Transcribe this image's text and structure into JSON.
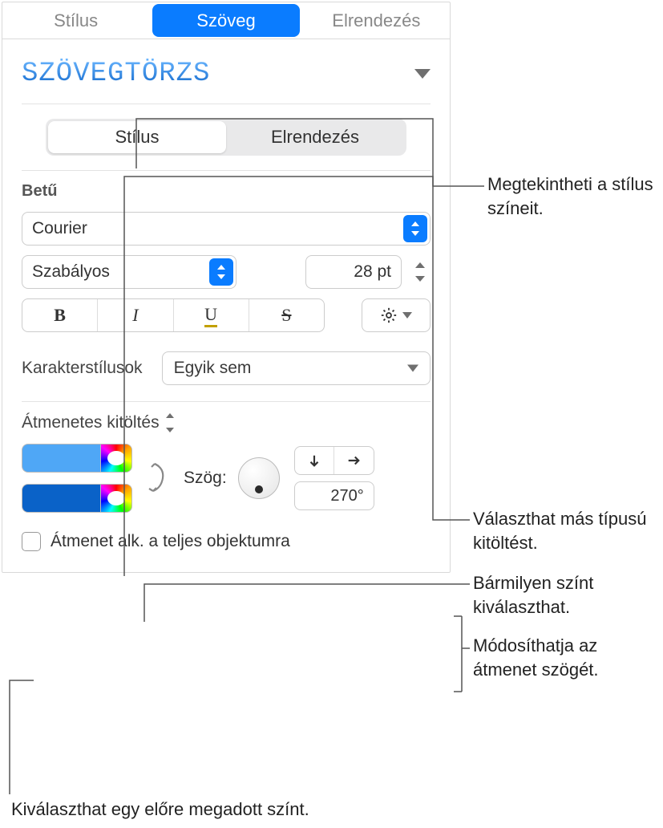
{
  "tabs": {
    "style": "Stílus",
    "text": "Szöveg",
    "layout": "Elrendezés"
  },
  "body_style_name": "Szövegtörzs",
  "sub_tabs": {
    "style": "Stílus",
    "layout": "Elrendezés"
  },
  "font": {
    "heading": "Betű",
    "family": "Courier",
    "weight": "Szabályos",
    "size": "28 pt",
    "char_styles_label": "Karakterstílusok",
    "char_styles_value": "Egyik sem"
  },
  "fill": {
    "type_label": "Átmenetes kitöltés",
    "angle_label": "Szög:",
    "angle_value": "270°",
    "apply_checkbox_label": "Átmenet alk. a teljes objektumra"
  },
  "callouts": {
    "view_colors": "Megtekintheti a stílus színeit.",
    "other_fill": "Választhat más típusú kitöltést.",
    "any_color": "Bármilyen színt kiválaszthat.",
    "change_angle": "Módosíthatja az átmenet szögét.",
    "preset_color": "Kiválaszthat egy előre megadott színt."
  }
}
